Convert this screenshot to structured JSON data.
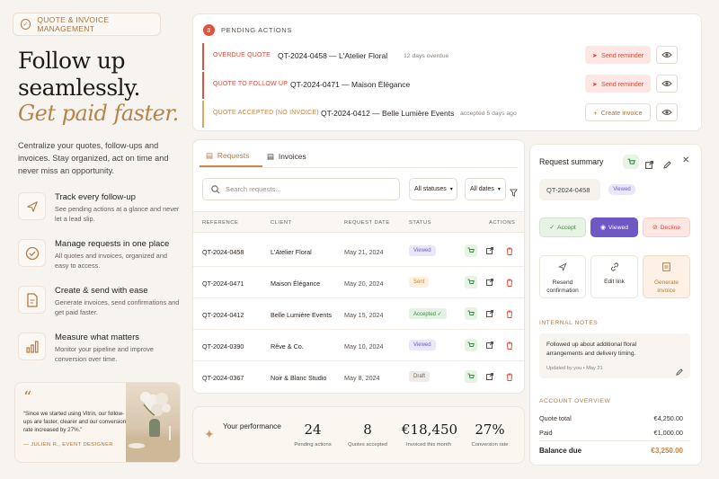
{
  "hero": {
    "badge": "QUOTE & INVOICE MANAGEMENT",
    "title_line1": "Follow up",
    "title_line2": "seamlessly.",
    "title_italic": "Get paid faster.",
    "intro": "Centralize your quotes, follow-ups and invoices. Stay organized, act on time and never miss an opportunity."
  },
  "features": [
    {
      "title": "Track every follow-up",
      "desc": "See pending actions at a glance and never let a lead slip.",
      "icon": "send-icon"
    },
    {
      "title": "Manage requests in one place",
      "desc": "All quotes and invoices, organized and easy to access.",
      "icon": "check-circle-icon"
    },
    {
      "title": "Create & send with ease",
      "desc": "Generate invoices, send confirmations and get paid faster.",
      "icon": "document-icon"
    },
    {
      "title": "Measure what matters",
      "desc": "Monitor your pipeline and improve conversion over time.",
      "icon": "bar-chart-icon"
    }
  ],
  "testimonial": {
    "quote": "“Since we started using Vitrin, our follow-ups are faster, clearer and our conversion rate increased by 27%.”",
    "author": "— JULIEN R., EVENT DESIGNER"
  },
  "pending": {
    "count": "3",
    "heading": "PENDING ACTIONS",
    "rows": [
      {
        "tag": "OVERDUE QUOTE",
        "ref": "QT-2024-0458 — L'Atelier Floral",
        "meta": "12 days overdue",
        "action": "Send reminder"
      },
      {
        "tag": "QUOTE TO FOLLOW UP",
        "ref": "QT-2024-0471 — Maison Élégance",
        "meta": "",
        "action": "Send reminder"
      },
      {
        "tag": "QUOTE ACCEPTED (NO INVOICE)",
        "ref": "QT-2024-0412 — Belle Lumière Events",
        "meta": "accepted 5 days ago",
        "action": "Create invoice"
      }
    ]
  },
  "tabs": {
    "requests": "Requests",
    "invoices": "Invoices"
  },
  "search": {
    "placeholder": "Search requests..."
  },
  "filters": {
    "status": "All statuses",
    "date": "All dates"
  },
  "table": {
    "headers": {
      "reference": "REFERENCE",
      "client": "CLIENT",
      "date": "REQUEST DATE",
      "status": "STATUS",
      "actions": "ACTIONS"
    },
    "rows": [
      {
        "ref": "QT-2024-0458",
        "client": "L'Atelier Floral",
        "date": "May 21, 2024",
        "status": "Viewed"
      },
      {
        "ref": "QT-2024-0471",
        "client": "Maison Élégance",
        "date": "May 20, 2024",
        "status": "Sent"
      },
      {
        "ref": "QT-2024-0412",
        "client": "Belle Lumière Events",
        "date": "May 15, 2024",
        "status": "Accepted ✓"
      },
      {
        "ref": "QT-2024-0390",
        "client": "Rêve & Co.",
        "date": "May 10, 2024",
        "status": "Viewed"
      },
      {
        "ref": "QT-2024-0367",
        "client": "Noir & Blanc Studio",
        "date": "May 8, 2024",
        "status": "Draft"
      }
    ]
  },
  "performance": {
    "label": "Your performance",
    "stats": [
      {
        "value": "24",
        "label": "Pending actions"
      },
      {
        "value": "8",
        "label": "Quotes accepted"
      },
      {
        "value": "€18,450",
        "label": "Invoiced this month"
      },
      {
        "value": "27%",
        "label": "Conversion rate"
      }
    ]
  },
  "summary": {
    "title": "Request summary",
    "ref": "QT-2024-0458",
    "status": "Viewed",
    "accept": "Accept",
    "viewed": "Viewed",
    "decline": "Decline",
    "resend": "Resend confirmation",
    "edit_link": "Edit link",
    "generate": "Generate invoice",
    "notes_heading": "INTERNAL NOTES",
    "note": "Followed up about additional floral arrangements and delivery timing.",
    "note_meta": "Updated by you • May 21",
    "account_heading": "ACCOUNT OVERVIEW",
    "quote_total_label": "Quote total",
    "quote_total": "€4,250.00",
    "paid_label": "Paid",
    "paid": "€1,000.00",
    "balance_label": "Balance due",
    "balance": "€3,250.00"
  },
  "colors": {
    "accent": "#b5844d",
    "danger": "#e05240",
    "primary": "#6e58c6"
  }
}
